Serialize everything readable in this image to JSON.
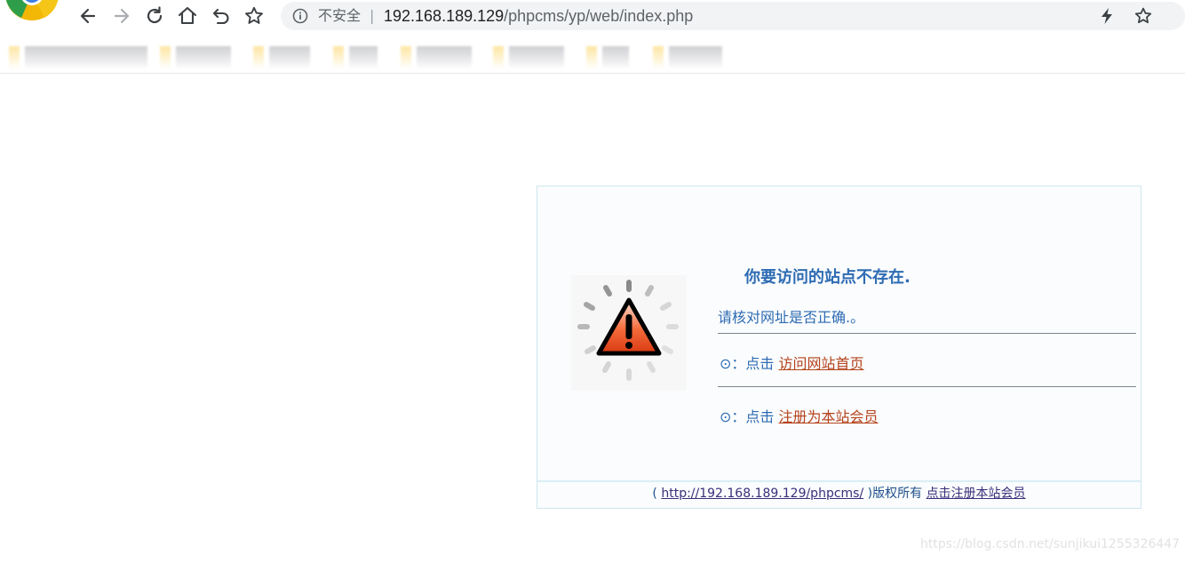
{
  "browser": {
    "security_label": "不安全",
    "separator": "|",
    "url_host": "192.168.189.129",
    "url_path": "/phpcms/yp/web/index.php",
    "bookmarks_bar_state": "blurred"
  },
  "error_page": {
    "title": "你要访问的站点不存在.",
    "message": "请核对网址是否正确.。",
    "options": [
      {
        "bullet": "⊙",
        "prefix": "：点击 ",
        "link_text": "访问网站首页"
      },
      {
        "bullet": "⊙",
        "prefix": "：点击 ",
        "link_text": "注册为本站会员"
      }
    ],
    "footer": {
      "open_paren": "( ",
      "site_link": "http://192.168.189.129/phpcms/",
      "rights": " )版权所有 ",
      "register_link": "点击注册本站会员"
    }
  },
  "watermark": "https://blog.csdn.net/sunjikui1255326447"
}
